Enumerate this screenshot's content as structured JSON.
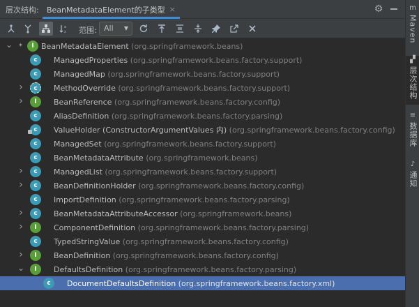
{
  "header": {
    "title": "层次结构:",
    "tab_label": "BeanMetadataElement的子类型",
    "tab_close": "×"
  },
  "toolbar": {
    "scope_label": "范围:",
    "scope_value": "All",
    "buttons": [
      "subtypes-hierarchy",
      "supertypes-hierarchy",
      "class-hierarchy",
      "sort-alphabetically",
      "refresh",
      "export",
      "expand-all",
      "collapse-all",
      "pin",
      "autoscroll",
      "close"
    ]
  },
  "right_strip": {
    "tabs": [
      {
        "label": "Maven",
        "icon": "m-icon"
      },
      {
        "label": "层次结构",
        "icon": "hierarchy-icon"
      },
      {
        "label": "数据库",
        "icon": "database-icon"
      },
      {
        "label": "通知",
        "icon": "bell-icon"
      }
    ]
  },
  "tree": {
    "rows": [
      {
        "name": "BeanMetadataElement",
        "pkg": "(org.springframework.beans)",
        "kind": "interface",
        "arrow": "down",
        "root": true
      },
      {
        "name": "ManagedProperties",
        "pkg": "(org.springframework.beans.factory.support)",
        "kind": "class",
        "arrow": "none"
      },
      {
        "name": "ManagedMap",
        "pkg": "(org.springframework.beans.factory.support)",
        "kind": "class",
        "arrow": "none"
      },
      {
        "name": "MethodOverride",
        "pkg": "(org.springframework.beans.factory.support)",
        "kind": "abstract",
        "arrow": "right"
      },
      {
        "name": "BeanReference",
        "pkg": "(org.springframework.beans.factory.config)",
        "kind": "interface",
        "arrow": "right"
      },
      {
        "name": "AliasDefinition",
        "pkg": "(org.springframework.beans.factory.parsing)",
        "kind": "class",
        "arrow": "none"
      },
      {
        "name": "ValueHolder (ConstructorArgumentValues 内)",
        "pkg": "(org.springframework.beans.factory.config)",
        "kind": "class-pinned",
        "arrow": "none"
      },
      {
        "name": "ManagedSet",
        "pkg": "(org.springframework.beans.factory.support)",
        "kind": "class",
        "arrow": "none"
      },
      {
        "name": "BeanMetadataAttribute",
        "pkg": "(org.springframework.beans)",
        "kind": "class",
        "arrow": "none"
      },
      {
        "name": "ManagedList",
        "pkg": "(org.springframework.beans.factory.support)",
        "kind": "class",
        "arrow": "right"
      },
      {
        "name": "BeanDefinitionHolder",
        "pkg": "(org.springframework.beans.factory.config)",
        "kind": "class",
        "arrow": "right"
      },
      {
        "name": "ImportDefinition",
        "pkg": "(org.springframework.beans.factory.parsing)",
        "kind": "class",
        "arrow": "none"
      },
      {
        "name": "BeanMetadataAttributeAccessor",
        "pkg": "(org.springframework.beans)",
        "kind": "class",
        "arrow": "right"
      },
      {
        "name": "ComponentDefinition",
        "pkg": "(org.springframework.beans.factory.parsing)",
        "kind": "interface",
        "arrow": "right"
      },
      {
        "name": "TypedStringValue",
        "pkg": "(org.springframework.beans.factory.config)",
        "kind": "class",
        "arrow": "none"
      },
      {
        "name": "BeanDefinition",
        "pkg": "(org.springframework.beans.factory.config)",
        "kind": "interface",
        "arrow": "right"
      },
      {
        "name": "DefaultsDefinition",
        "pkg": "(org.springframework.beans.factory.parsing)",
        "kind": "interface",
        "arrow": "down"
      },
      {
        "name": "DocumentDefaultsDefinition",
        "pkg": "(org.springframework.beans.factory.xml)",
        "kind": "class",
        "arrow": "none",
        "selected": true,
        "child": true
      }
    ]
  }
}
